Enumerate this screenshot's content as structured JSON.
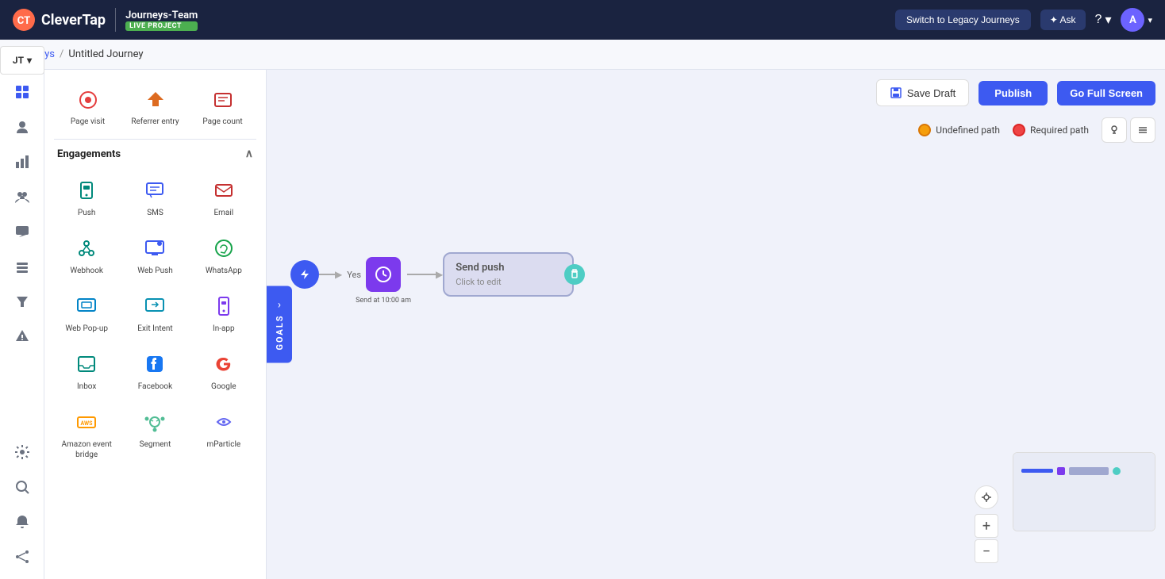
{
  "nav": {
    "logo": "CleverTap",
    "team_name": "Journeys-Team",
    "live_badge": "LIVE PROJECT",
    "switch_btn": "Switch to Legacy Journeys",
    "ask_btn": "✦ Ask",
    "avatar": "A"
  },
  "breadcrumb": {
    "parent": "Journeys",
    "separator": "/",
    "current": "Untitled Journey"
  },
  "jt_button": "JT",
  "toolbar": {
    "save_draft": "Save Draft",
    "publish": "Publish",
    "full_screen": "Go Full Screen"
  },
  "legend": {
    "undefined_path": "Undefined path",
    "required_path": "Required path"
  },
  "panel": {
    "triggers": [
      {
        "label": "Page visit",
        "icon": "👁"
      },
      {
        "label": "Referrer entry",
        "icon": "◇"
      },
      {
        "label": "Page count",
        "icon": "📊"
      }
    ],
    "engagements_title": "Engagements",
    "engagements": [
      {
        "label": "Push",
        "icon": "📱",
        "color": "teal"
      },
      {
        "label": "SMS",
        "icon": "💬",
        "color": "blue"
      },
      {
        "label": "Email",
        "icon": "✉",
        "color": "indigo"
      },
      {
        "label": "Webhook",
        "icon": "🔗",
        "color": "teal"
      },
      {
        "label": "Web Push",
        "icon": "🖥",
        "color": "blue"
      },
      {
        "label": "WhatsApp",
        "icon": "📞",
        "color": "green"
      },
      {
        "label": "Web Pop-up",
        "icon": "🌐",
        "color": "sky"
      },
      {
        "label": "Exit Intent",
        "icon": "🖥",
        "color": "cyan"
      },
      {
        "label": "In-app",
        "icon": "📲",
        "color": "purple"
      },
      {
        "label": "Inbox",
        "icon": "📥",
        "color": "teal"
      },
      {
        "label": "Facebook",
        "icon": "f",
        "color": "facebook"
      },
      {
        "label": "Google",
        "icon": "G",
        "color": "google"
      },
      {
        "label": "Amazon event bridge",
        "icon": "AWS",
        "color": "aws"
      },
      {
        "label": "Segment",
        "icon": "S",
        "color": "segment"
      },
      {
        "label": "mParticle",
        "icon": "m",
        "color": "mparticle"
      }
    ]
  },
  "goals_tab": "GOALS",
  "flow": {
    "yes_label": "Yes",
    "send_push_title": "Send push",
    "send_push_sub": "Click to edit",
    "delay_label": "Send at 10:00 am"
  },
  "sidebar_icons": [
    "grid",
    "user-circle",
    "chart-bar",
    "users",
    "chat",
    "layers",
    "filter",
    "alert",
    "bell",
    "network"
  ],
  "zoom": {
    "plus": "+",
    "minus": "−"
  }
}
